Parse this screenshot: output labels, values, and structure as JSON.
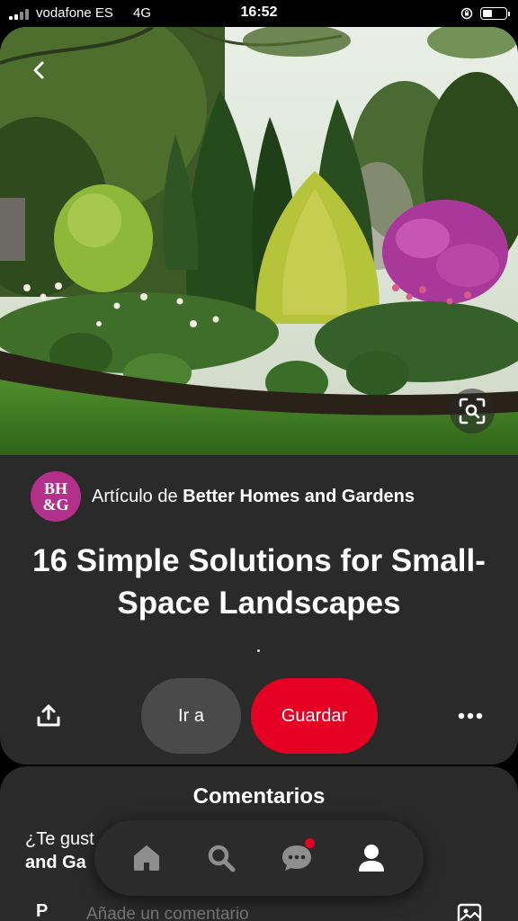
{
  "status_bar": {
    "carrier": "vodafone ES",
    "network": "4G",
    "time": "16:52"
  },
  "pin": {
    "image_description_icon": "garden-photo",
    "source_logo_line1": "BH",
    "source_logo_line2": "&G",
    "source_prefix": "Artículo de ",
    "source_name": "Better Homes and Gardens",
    "title": "16 Simple Solutions for Small-Space Landscapes",
    "dot": ".",
    "visit_label": "Ir a",
    "save_label": "Guardar"
  },
  "comments": {
    "title": "Comentarios",
    "prompt_line1": "¿Te gust",
    "prompt_line2": "and Ga",
    "avatar_initial": "P",
    "input_placeholder": "Añade un comentario"
  },
  "nav": {
    "items": [
      "home-icon",
      "search-icon",
      "messages-icon",
      "profile-icon"
    ]
  },
  "colors": {
    "save_button": "#e60023",
    "brand_logo": "#b3318a",
    "card_background": "#2a2a2a"
  }
}
